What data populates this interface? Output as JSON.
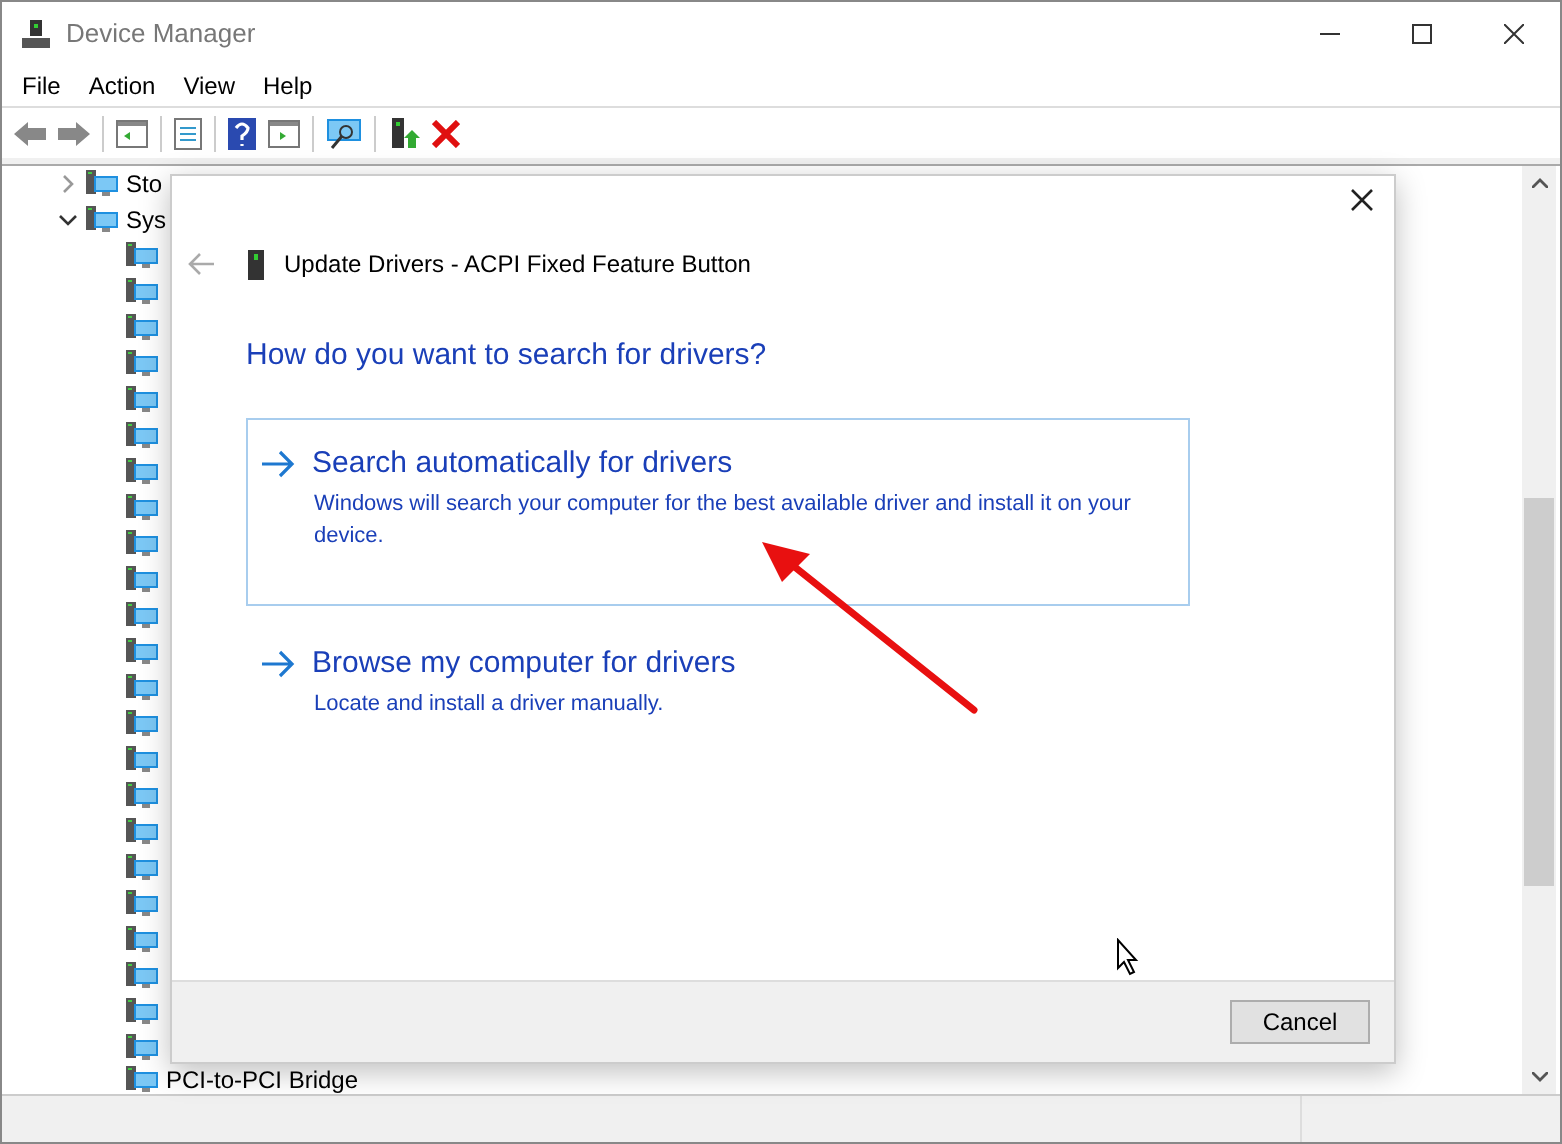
{
  "window": {
    "title": "Device Manager"
  },
  "menu": [
    "File",
    "Action",
    "View",
    "Help"
  ],
  "tree": [
    {
      "label": "Sto",
      "expanded": false
    },
    {
      "label": "Sys",
      "expanded": true,
      "children": [
        {
          "label": "PCI-to-PCI Bridge"
        }
      ]
    }
  ],
  "dialog": {
    "title": "Update Drivers - ACPI Fixed Feature Button",
    "heading": "How do you want to search for drivers?",
    "options": [
      {
        "title": "Search automatically for drivers",
        "description": "Windows will search your computer for the best available driver and install it on your device.",
        "selected": true
      },
      {
        "title": "Browse my computer for drivers",
        "description": "Locate and install a driver manually.",
        "selected": false
      }
    ],
    "buttons": [
      "Cancel"
    ]
  }
}
